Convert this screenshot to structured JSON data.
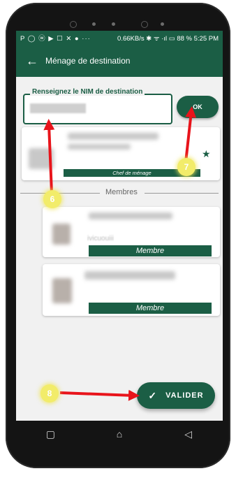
{
  "statusbar": {
    "left_icons": "P ◯ ⓦ ▶ ☐ ✕ ● ···",
    "right": "0.66KB/s ✱ ᯤ ·ıl ▭ 88 % 5:25 PM"
  },
  "appbar": {
    "back_icon": "arrow-left-icon",
    "title": "Ménage de destination"
  },
  "nim": {
    "label": "Renseignez le NIM de destination",
    "ok_label": "OK"
  },
  "head_card": {
    "badge": "Chef de ménage",
    "star_icon": "star-icon"
  },
  "members": {
    "divider_label": "Membres",
    "items": [
      {
        "partial_text": "ivicuouiii",
        "badge": "Membre"
      },
      {
        "badge": "Membre"
      }
    ]
  },
  "valider": {
    "label": "VALIDER",
    "icon": "check-icon"
  },
  "markers": {
    "six": "6",
    "seven": "7",
    "eight": "8"
  },
  "colors": {
    "primary": "#1b5e45",
    "arrow": "#e8141b",
    "marker": "#f2ec6a"
  },
  "navbar": {
    "square": "▢",
    "home": "⌂",
    "back": "◁"
  }
}
